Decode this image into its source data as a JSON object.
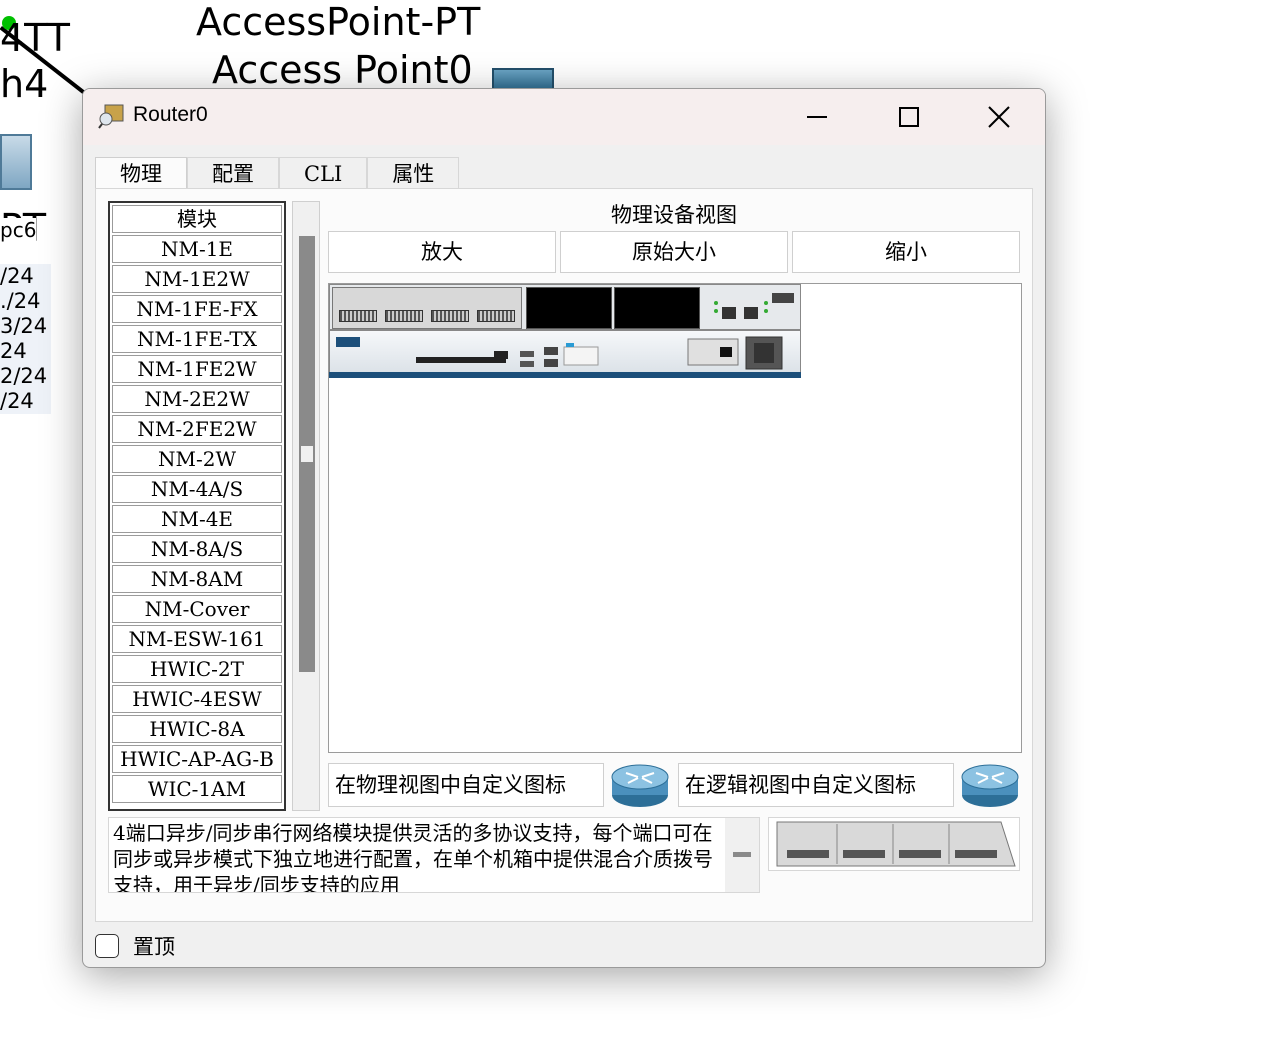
{
  "background": {
    "ap_name": "AccessPoint-PT",
    "ap_label": "Access Point0",
    "frag_4tt": "4TT",
    "frag_h4": "h4",
    "frag_pt": "PT",
    "frag_pc6": "pc6",
    "ip_fragments": [
      "/24",
      "./24",
      "3/24",
      "24",
      "2/24",
      "/24"
    ]
  },
  "window": {
    "title": "Router0",
    "controls": {
      "minimize": "minimize",
      "maximize": "maximize",
      "close": "close"
    }
  },
  "tabs": [
    {
      "label": "物理",
      "active": true
    },
    {
      "label": "配置",
      "active": false
    },
    {
      "label": "CLI",
      "active": false
    },
    {
      "label": "属性",
      "active": false
    }
  ],
  "modules": {
    "header": "模块",
    "items": [
      "NM-1E",
      "NM-1E2W",
      "NM-1FE-FX",
      "NM-1FE-TX",
      "NM-1FE2W",
      "NM-2E2W",
      "NM-2FE2W",
      "NM-2W",
      "NM-4A/S",
      "NM-4E",
      "NM-8A/S",
      "NM-8AM",
      "NM-Cover",
      "NM-ESW-161",
      "HWIC-2T",
      "HWIC-4ESW",
      "HWIC-8A",
      "HWIC-AP-AG-B",
      "WIC-1AM"
    ]
  },
  "physical_view": {
    "title": "物理设备视图",
    "zoom_in": "放大",
    "original_size": "原始大小",
    "zoom_out": "缩小"
  },
  "customize": {
    "physical_icon": "在物理视图中自定义图标",
    "logical_icon": "在逻辑视图中自定义图标"
  },
  "description": "4端口异步/同步串行网络模块提供灵活的多协议支持，每个端口可在同步或异步模式下独立地进行配置，在单个机箱中提供混合介质拨号支持，用于异步/同步支持的应用",
  "always_on_top": {
    "label": "置顶",
    "checked": false
  },
  "colors": {
    "title_bar": "#f6eeee",
    "router_stripe": "#1c4f7a",
    "window_bg": "#f0f0f0"
  }
}
